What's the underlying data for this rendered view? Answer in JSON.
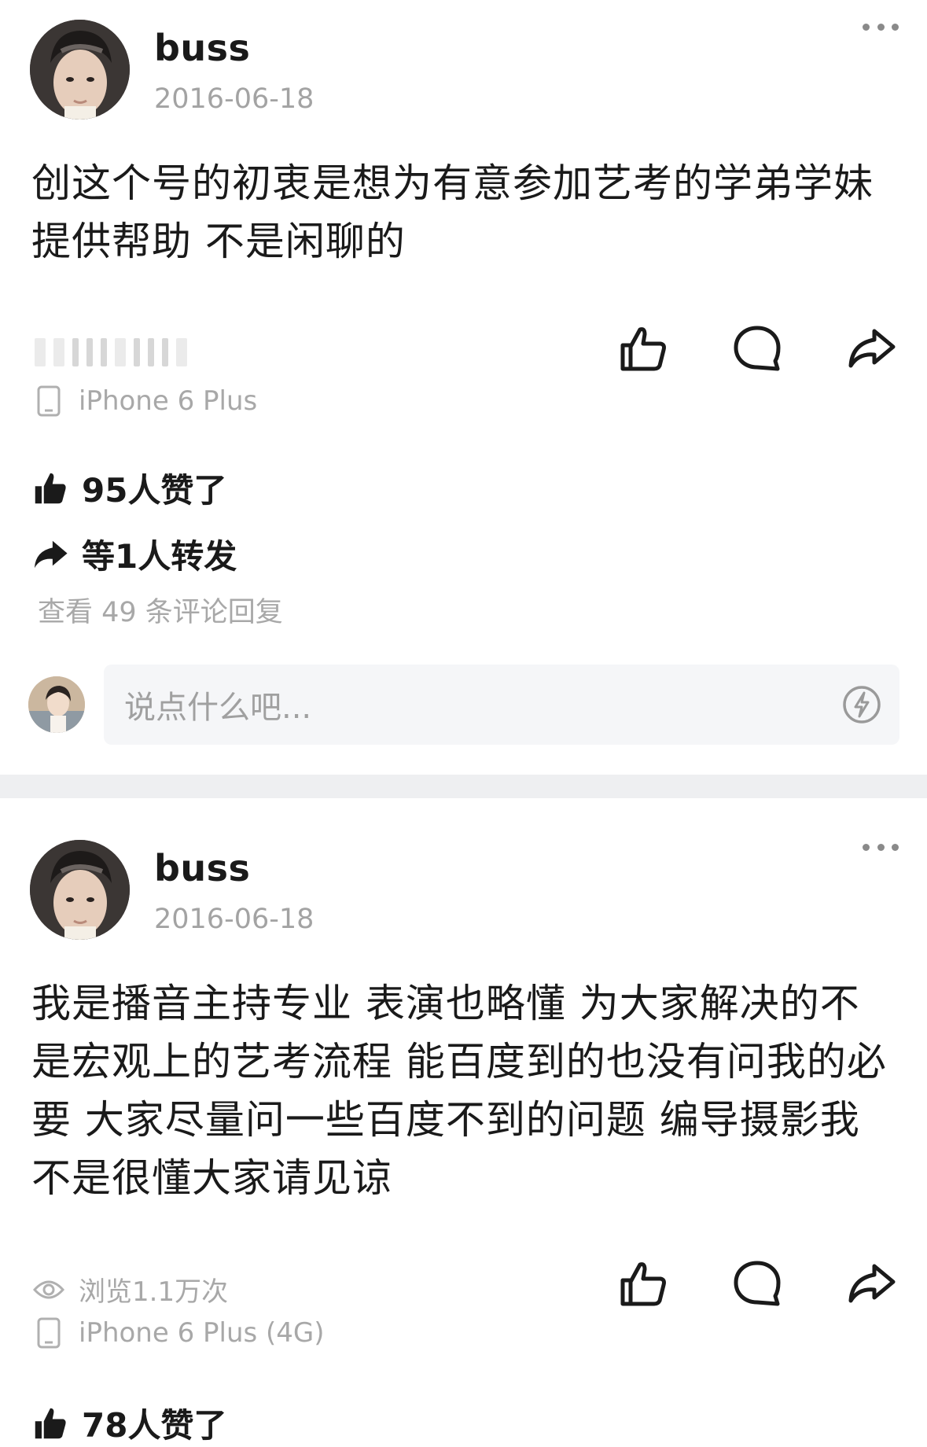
{
  "posts": [
    {
      "author": "buss",
      "date": "2016-06-18",
      "content": "创这个号的初衷是想为有意参加艺考的学弟学妹提供帮助 不是闲聊的",
      "device": "iPhone 6 Plus",
      "likes_text": "95人赞了",
      "reposts_text": "等1人转发",
      "view_comments": "查看 49 条评论回复",
      "comment_placeholder": "说点什么吧..."
    },
    {
      "author": "buss",
      "date": "2016-06-18",
      "content": "我是播音主持专业 表演也略懂 为大家解决的不是宏观上的艺考流程 能百度到的也没有问我的必要 大家尽量问一些百度不到的问题 编导摄影我不是很懂大家请见谅",
      "views": "浏览1.1万次",
      "device": "iPhone 6 Plus (4G)",
      "likes_text": "78人赞了"
    }
  ],
  "icons": {
    "like": "thumbs-up-icon",
    "comment": "comment-bubble-icon",
    "share": "share-arrow-icon",
    "more": "more-dots-icon",
    "device": "phone-icon",
    "views": "eye-icon",
    "emoji": "lightning-emoji-icon"
  },
  "colors": {
    "text": "#1a1a1a",
    "muted": "#a8a8a8",
    "divider": "#eeeff1",
    "input_bg": "#f5f6f8"
  }
}
